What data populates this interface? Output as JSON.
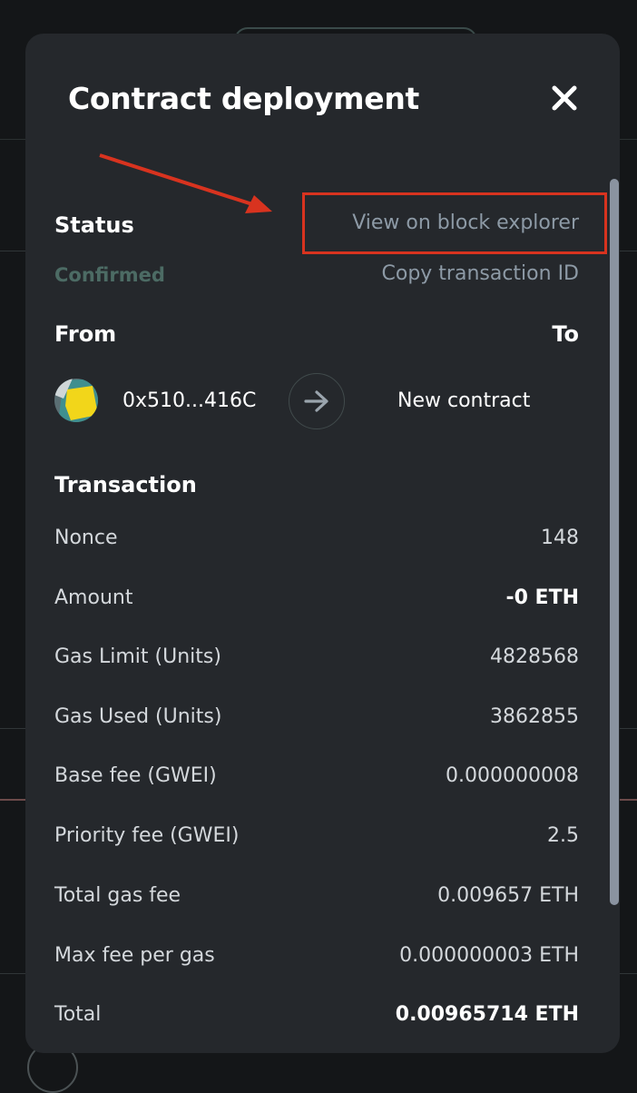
{
  "modal": {
    "title": "Contract deployment"
  },
  "status": {
    "label": "Status",
    "value": "Confirmed",
    "view_explorer_link": "View on block explorer",
    "copy_tx_link": "Copy transaction ID"
  },
  "parties": {
    "from_label": "From",
    "to_label": "To",
    "from_address": "0x510...416C",
    "to_value": "New contract"
  },
  "transaction": {
    "heading": "Transaction",
    "rows": [
      {
        "label": "Nonce",
        "value": "148",
        "bold": false
      },
      {
        "label": "Amount",
        "value": "-0 ETH",
        "bold": true
      },
      {
        "label": "Gas Limit (Units)",
        "value": "4828568",
        "bold": false
      },
      {
        "label": "Gas Used (Units)",
        "value": "3862855",
        "bold": false
      },
      {
        "label": "Base fee (GWEI)",
        "value": "0.000000008",
        "bold": false
      },
      {
        "label": "Priority fee (GWEI)",
        "value": "2.5",
        "bold": false
      },
      {
        "label": "Total gas fee",
        "value": "0.009657 ETH",
        "bold": false
      },
      {
        "label": "Max fee per gas",
        "value": "0.000000003 ETH",
        "bold": false
      },
      {
        "label": "Total",
        "value": "0.00965714 ETH",
        "bold": true
      }
    ]
  },
  "colors": {
    "modal_bg": "#25282c",
    "confirmed": "#4c6b64",
    "link": "#8d9aa6",
    "annotation": "#d8331f",
    "avatar_yellow": "#f2d61a"
  },
  "icons": {
    "close": "close-icon",
    "arrow": "arrow-right-icon",
    "avatar": "jazzicon-avatar"
  }
}
